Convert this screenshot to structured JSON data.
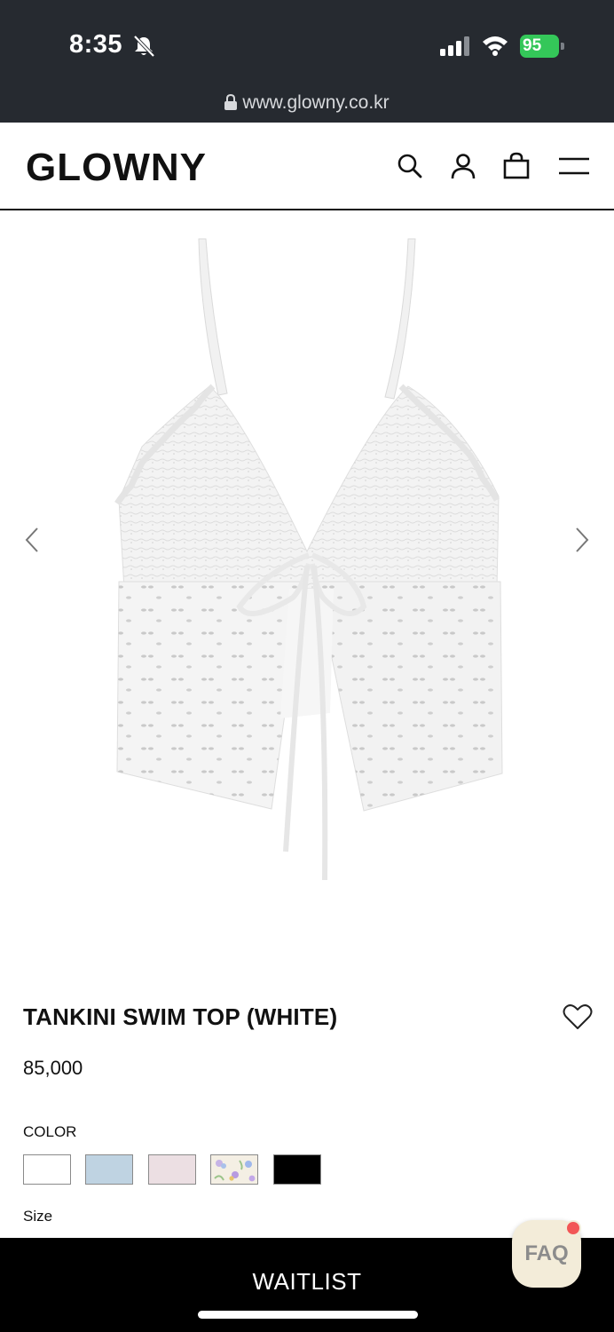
{
  "status_bar": {
    "time": "8:35",
    "battery": "95",
    "icons": [
      "bell-slash-icon",
      "cellular-signal-icon",
      "wifi-icon",
      "battery-charging-icon"
    ]
  },
  "browser": {
    "url": "www.glowny.co.kr",
    "icon": "lock-icon"
  },
  "header": {
    "logo": "GLOWNY",
    "icons": [
      "search-icon",
      "user-icon",
      "shopping-bag-icon",
      "menu-icon"
    ]
  },
  "gallery": {
    "prev_icon": "chevron-left-icon",
    "next_icon": "chevron-right-icon"
  },
  "product": {
    "title": "TANKINI SWIM TOP (WHITE)",
    "price": "85,000",
    "wishlist_icon": "heart-icon",
    "color_label": "COLOR",
    "colors": [
      {
        "name": "white",
        "hex": "#ffffff"
      },
      {
        "name": "light-blue",
        "hex": "#bfd3e2"
      },
      {
        "name": "light-pink",
        "hex": "#ecdfe3"
      },
      {
        "name": "floral",
        "hex": "#f4efe4"
      },
      {
        "name": "black",
        "hex": "#000000"
      }
    ],
    "size_label": "Size"
  },
  "cta": {
    "label": "WAITLIST"
  },
  "faq": {
    "label": "FAQ",
    "badge_color": "#f25656"
  }
}
